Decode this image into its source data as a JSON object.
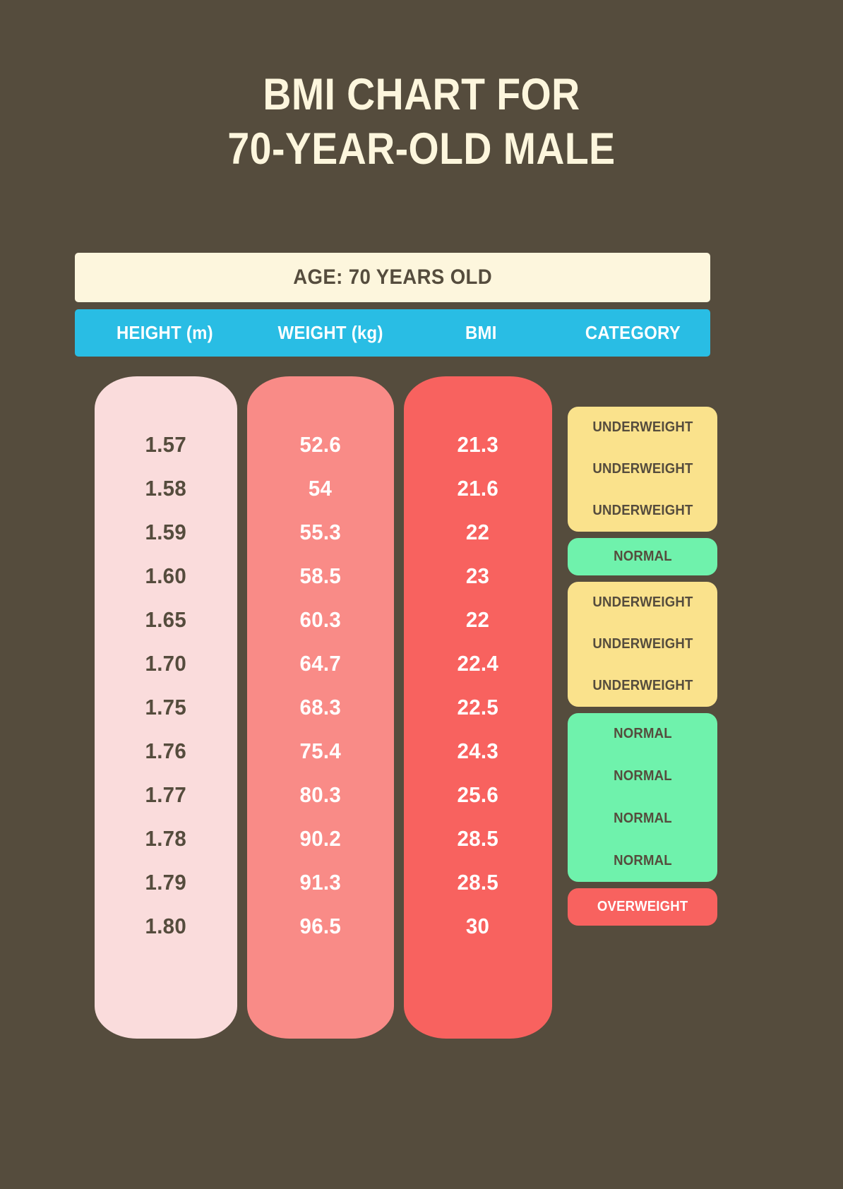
{
  "title": {
    "line1": "BMI CHART FOR",
    "line2": "70-YEAR-OLD MALE"
  },
  "age_bar": {
    "label": "AGE: 70 YEARS OLD"
  },
  "headers": {
    "height": "HEIGHT (m)",
    "weight": "WEIGHT (kg)",
    "bmi": "BMI",
    "category": "CATEGORY"
  },
  "colors": {
    "background": "#554C3D",
    "title_text": "#FDF6DD",
    "age_bar_bg": "#FDF6DD",
    "header_bg": "#29BDE4",
    "header_text": "#FFFFFF",
    "height_col_bg": "#FADCDC",
    "weight_col_bg": "#F98B87",
    "bmi_col_bg": "#F8625F",
    "underweight": "#FAE28C",
    "normal": "#6FF2AC",
    "overweight": "#F8625F"
  },
  "chart_data": {
    "type": "table",
    "title": "BMI CHART FOR 70-YEAR-OLD MALE",
    "subtitle": "AGE: 70 YEARS OLD",
    "columns": [
      "HEIGHT (m)",
      "WEIGHT (kg)",
      "BMI",
      "CATEGORY"
    ],
    "heights": [
      "1.57",
      "1.58",
      "1.59",
      "1.60",
      "1.65",
      "1.70",
      "1.75",
      "1.76",
      "1.77",
      "1.78",
      "1.79",
      "1.80"
    ],
    "weights": [
      "52.6",
      "54",
      "55.3",
      "58.5",
      "60.3",
      "64.7",
      "68.3",
      "75.4",
      "80.3",
      "90.2",
      "91.3",
      "96.5"
    ],
    "bmis": [
      "21.3",
      "21.6",
      "22",
      "23",
      "22",
      "22.4",
      "22.5",
      "24.3",
      "25.6",
      "28.5",
      "28.5",
      "30"
    ],
    "categories": [
      "UNDERWEIGHT",
      "UNDERWEIGHT",
      "UNDERWEIGHT",
      "NORMAL",
      "UNDERWEIGHT",
      "UNDERWEIGHT",
      "UNDERWEIGHT",
      "NORMAL",
      "NORMAL",
      "NORMAL",
      "NORMAL",
      "OVERWEIGHT"
    ],
    "rows": [
      {
        "height": "1.57",
        "weight": "52.6",
        "bmi": "21.3",
        "category": "UNDERWEIGHT"
      },
      {
        "height": "1.58",
        "weight": "54",
        "bmi": "21.6",
        "category": "UNDERWEIGHT"
      },
      {
        "height": "1.59",
        "weight": "55.3",
        "bmi": "22",
        "category": "UNDERWEIGHT"
      },
      {
        "height": "1.60",
        "weight": "58.5",
        "bmi": "23",
        "category": "NORMAL"
      },
      {
        "height": "1.65",
        "weight": "60.3",
        "bmi": "22",
        "category": "UNDERWEIGHT"
      },
      {
        "height": "1.70",
        "weight": "64.7",
        "bmi": "22.4",
        "category": "UNDERWEIGHT"
      },
      {
        "height": "1.75",
        "weight": "68.3",
        "bmi": "22.5",
        "category": "UNDERWEIGHT"
      },
      {
        "height": "1.76",
        "weight": "75.4",
        "bmi": "24.3",
        "category": "NORMAL"
      },
      {
        "height": "1.77",
        "weight": "80.3",
        "bmi": "25.6",
        "category": "NORMAL"
      },
      {
        "height": "1.78",
        "weight": "90.2",
        "bmi": "28.5",
        "category": "NORMAL"
      },
      {
        "height": "1.79",
        "weight": "91.3",
        "bmi": "28.5",
        "category": "NORMAL"
      },
      {
        "height": "1.80",
        "weight": "96.5",
        "bmi": "30",
        "category": "OVERWEIGHT"
      }
    ],
    "category_groups": [
      {
        "label": "UNDERWEIGHT",
        "count": 3,
        "kind": "underweight"
      },
      {
        "label": "NORMAL",
        "count": 1,
        "kind": "normal"
      },
      {
        "label": "UNDERWEIGHT",
        "count": 3,
        "kind": "underweight"
      },
      {
        "label": "NORMAL",
        "count": 4,
        "kind": "normal"
      },
      {
        "label": "OVERWEIGHT",
        "count": 1,
        "kind": "overweight"
      }
    ]
  }
}
